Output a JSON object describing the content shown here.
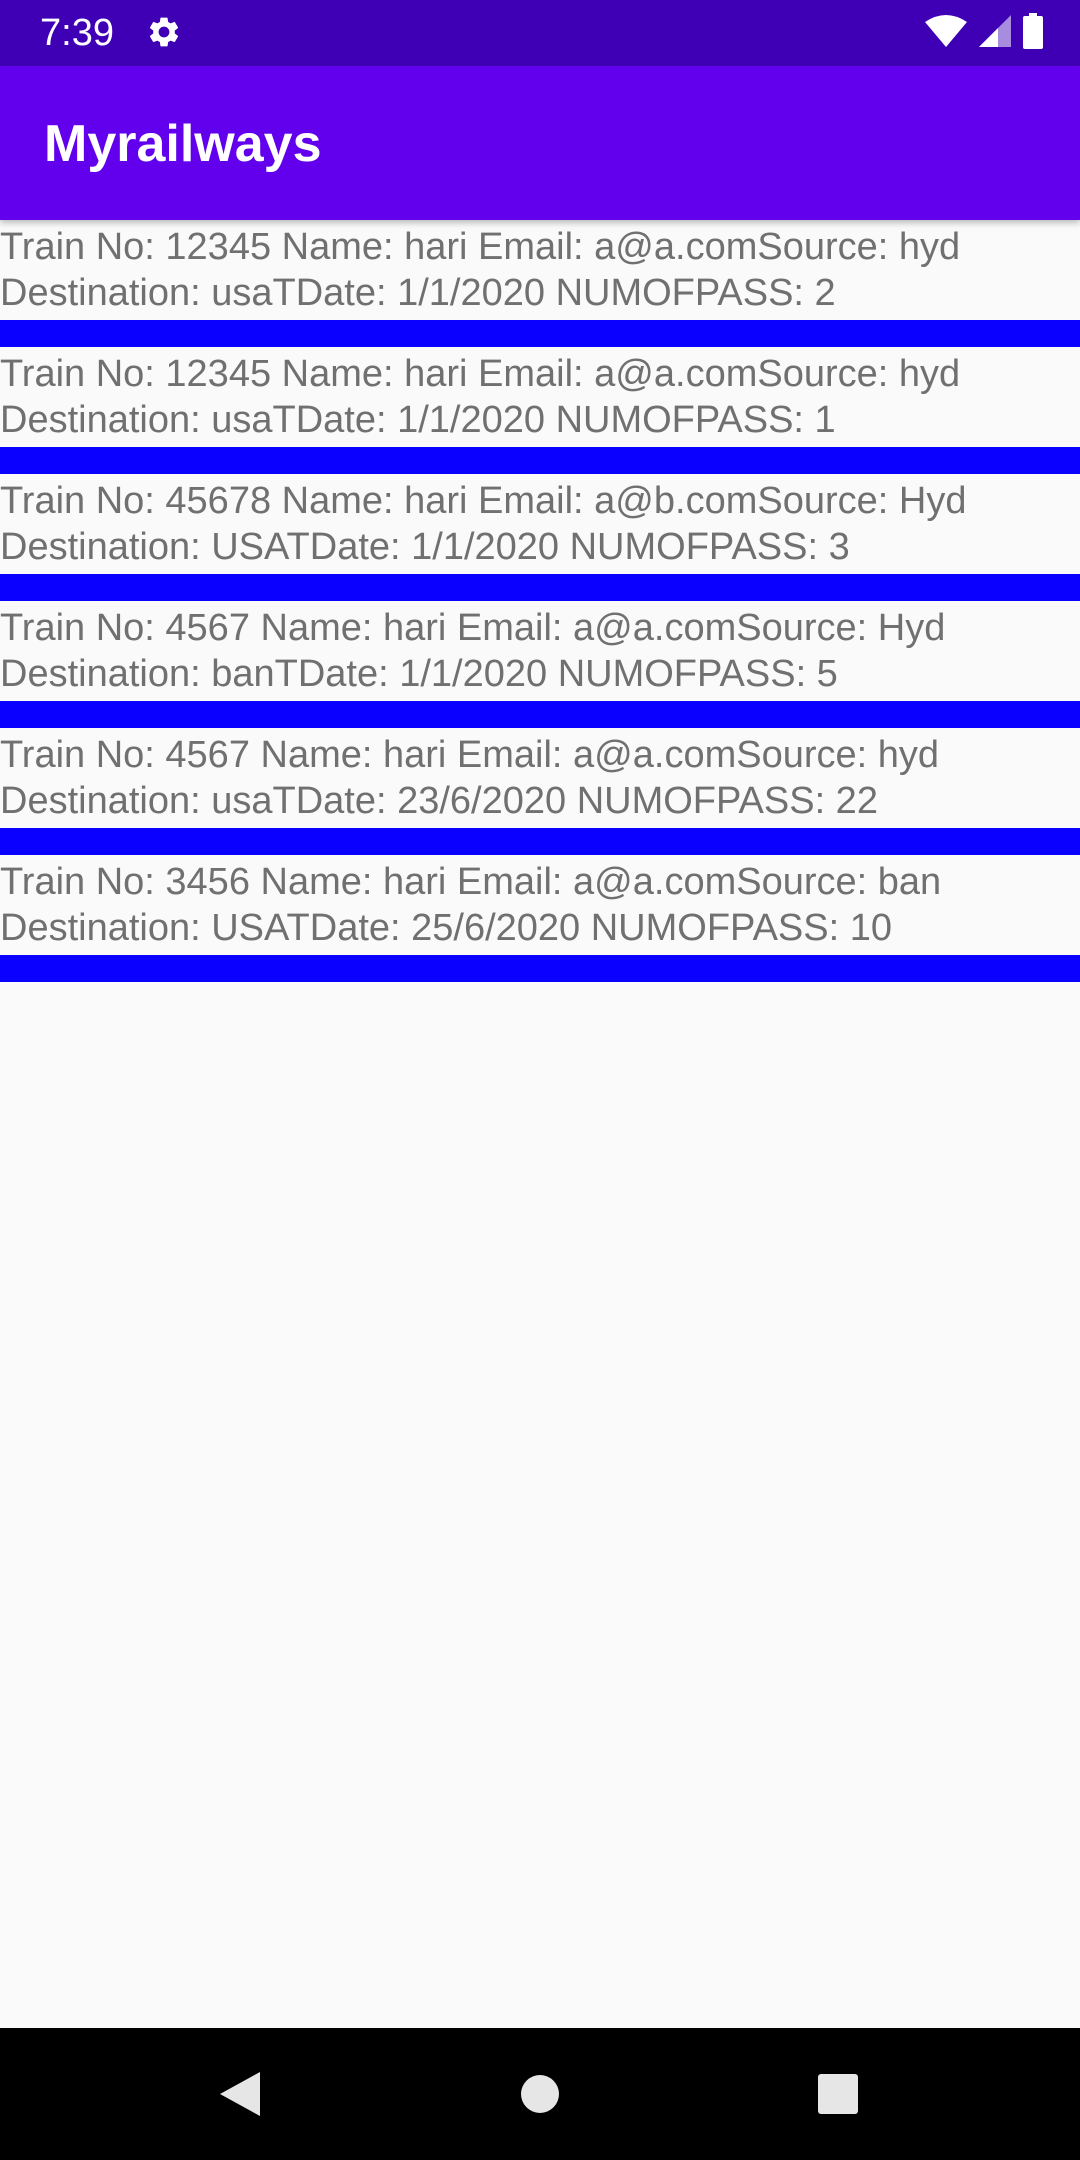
{
  "status_bar": {
    "time": "7:39",
    "icons": [
      "settings-icon",
      "wifi-icon",
      "signal-icon",
      "battery-icon"
    ]
  },
  "app_bar": {
    "title": "Myrailways"
  },
  "bookings": [
    {
      "line1": "Train No: 12345 Name: hari Email: a@a.comSource: hyd",
      "line2": "Destination: usaTDate: 1/1/2020 NUMOFPASS: 2"
    },
    {
      "line1": "Train No: 12345 Name: hari Email: a@a.comSource: hyd",
      "line2": "Destination: usaTDate: 1/1/2020 NUMOFPASS: 1"
    },
    {
      "line1": "Train No: 45678 Name: hari Email: a@b.comSource: Hyd",
      "line2": "Destination: USATDate: 1/1/2020 NUMOFPASS: 3"
    },
    {
      "line1": "Train No: 4567 Name: hari Email: a@a.comSource: Hyd",
      "line2": "Destination: banTDate: 1/1/2020 NUMOFPASS: 5"
    },
    {
      "line1": "Train No: 4567 Name: hari Email: a@a.comSource: hyd",
      "line2": "Destination: usaTDate: 23/6/2020 NUMOFPASS: 22"
    },
    {
      "line1": "Train No: 3456 Name: hari Email: a@a.comSource: ban",
      "line2": "Destination: USATDate: 25/6/2020 NUMOFPASS: 10"
    }
  ],
  "nav_bar": {
    "icons": [
      "back-icon",
      "home-icon",
      "recents-icon"
    ]
  },
  "colors": {
    "status_bar": "#3f00b5",
    "app_bar": "#6200ee",
    "divider": "#0a00ff",
    "text": "#707070",
    "background": "#fafafa"
  }
}
